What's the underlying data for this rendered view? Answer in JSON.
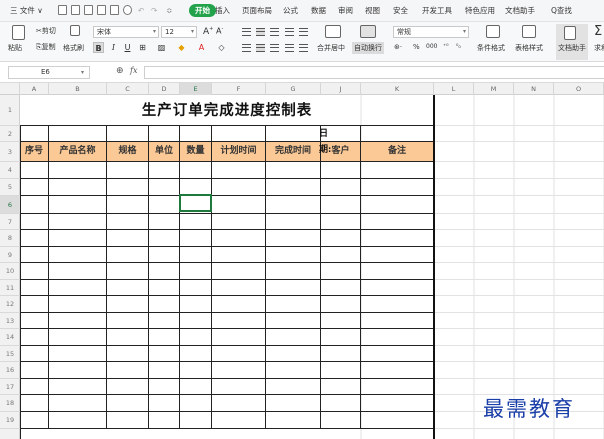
{
  "menubar": {
    "file_menu": "三 文件 ∨",
    "tabs": [
      "开始",
      "插入",
      "页面布局",
      "公式",
      "数据",
      "审阅",
      "视图",
      "安全",
      "开发工具",
      "特色应用",
      "文档助手"
    ],
    "search": "Q查找"
  },
  "toolbar": {
    "paste": "粘贴",
    "cut": "剪切",
    "copy": "复制",
    "format_painter": "格式刷",
    "font_name": "宋体",
    "font_size": "12",
    "bold": "B",
    "italic": "I",
    "underline": "U",
    "merge_center": "合并居中",
    "wrap_text": "自动换行",
    "number_format": "常规",
    "percent": "%",
    "thousands": "000",
    "conditional_format": "条件格式",
    "table_style": "表格样式",
    "doc_assistant": "文档助手",
    "sum": "求和"
  },
  "formula_bar": {
    "cell_ref": "E6",
    "fx": "fx",
    "value": ""
  },
  "columns": [
    "A",
    "B",
    "C",
    "D",
    "E",
    "F",
    "G",
    "J",
    "K",
    "L",
    "M",
    "N",
    "O"
  ],
  "active_column": "E",
  "rows": [
    "1",
    "2",
    "3",
    "4",
    "5",
    "6",
    "7",
    "8",
    "9",
    "10",
    "11",
    "12",
    "13",
    "14",
    "15",
    "16",
    "17",
    "18",
    "19"
  ],
  "active_row": "6",
  "sheet": {
    "title": "生产订单完成进度控制表",
    "date_label": "日期:",
    "headers": [
      "序号",
      "产品名称",
      "规格",
      "单位",
      "数量",
      "计划时间",
      "完成时间",
      "客户",
      "备注"
    ]
  },
  "watermark": "最需教育",
  "colors": {
    "accent_green": "#22a24a",
    "header_fill": "#fbc996",
    "selection_border": "#1e7a3c",
    "watermark": "#1a3fa8"
  }
}
